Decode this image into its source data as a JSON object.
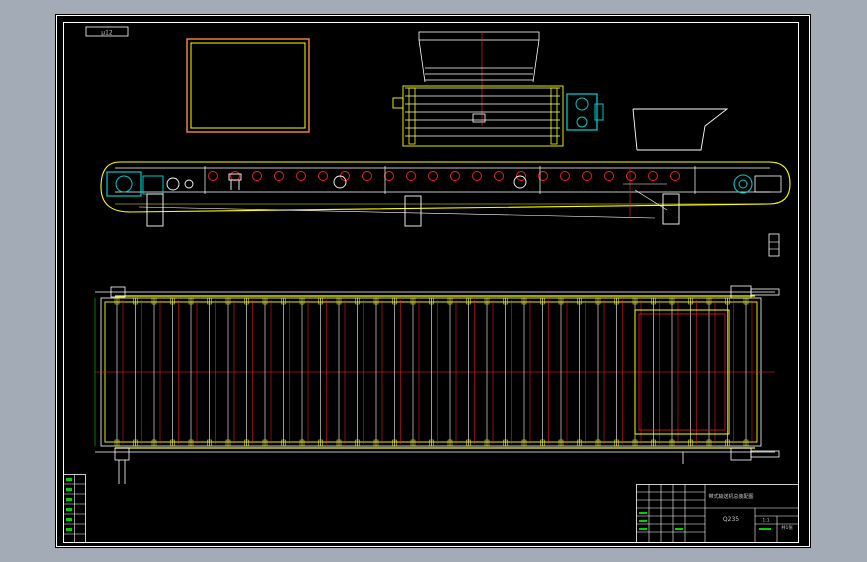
{
  "drawing": {
    "sheet_tag": "μ12",
    "title_block": {
      "drawing_name": "带式输送机总装配图",
      "drawing_number": "Q235",
      "scale": "1:1",
      "sheet": "共1张"
    }
  },
  "colors": {
    "sheet_background": "#a3abb6",
    "canvas": "#000000",
    "frame": "#ffffff",
    "yellow": "#ffff00",
    "white": "#ffffff",
    "red": "#ff2020",
    "teal": "#00c8c8",
    "green": "#00d000"
  }
}
